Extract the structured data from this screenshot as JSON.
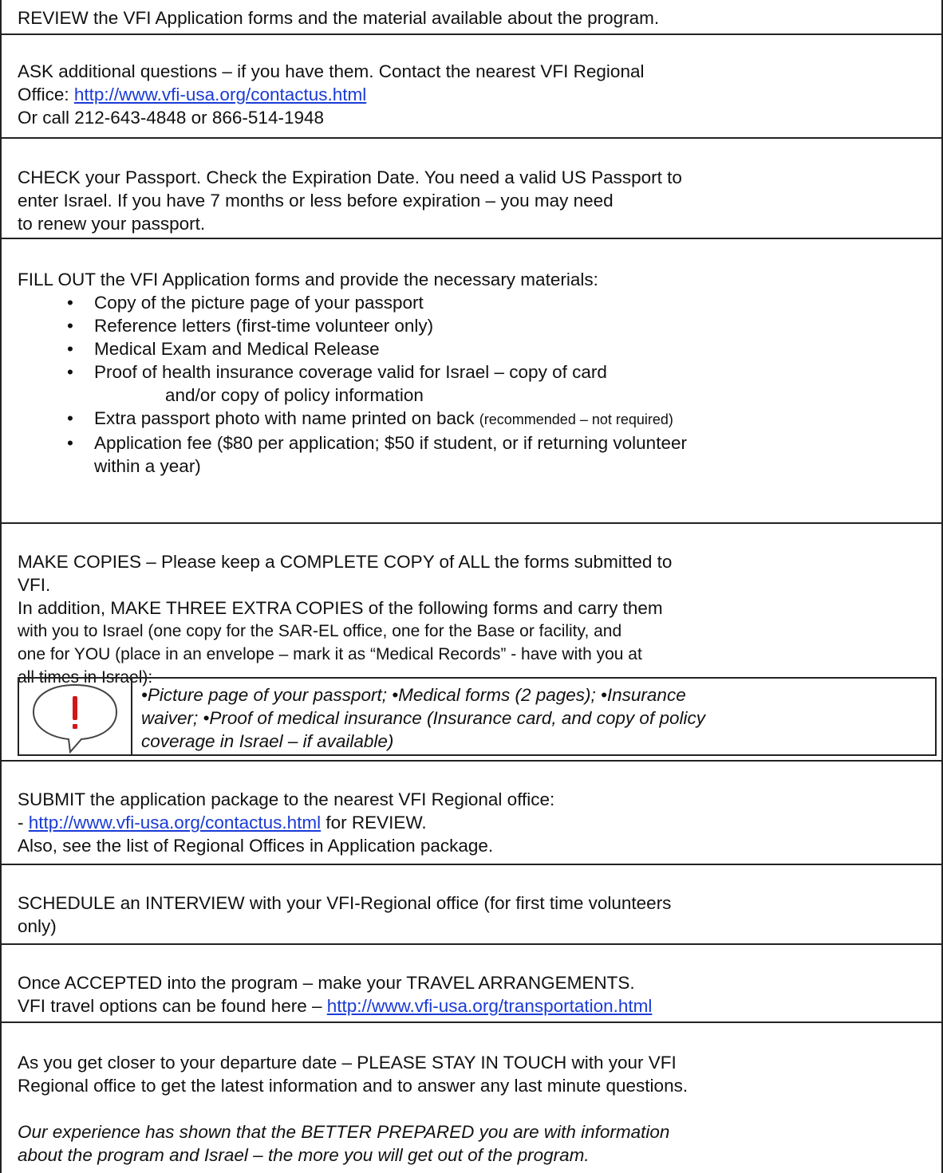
{
  "s1": {
    "line": "REVIEW the VFI Application forms and the material available about the program."
  },
  "s2": {
    "line1": "ASK additional questions – if you have them. Contact the nearest VFI Regional",
    "line2_prefix": "Office: ",
    "link": "http://www.vfi-usa.org/contactus.html",
    "line3": "Or call 212-643-4848 or 866-514-1948"
  },
  "s3": {
    "line1": "CHECK your Passport. Check the Expiration Date. You need a valid US Passport to",
    "line2": "enter Israel.  If you have 7 months or less before expiration – you may need",
    "line3": "to renew your passport."
  },
  "s4": {
    "intro": "FILL OUT the VFI Application forms and provide the necessary materials:",
    "bullet": "•",
    "item1": "Copy of the picture page of your passport",
    "item2": "Reference letters (first-time volunteer only)",
    "item3": "Medical Exam and Medical Release",
    "item4a": "Proof of health insurance coverage valid for Israel – copy of card",
    "item4b": "and/or copy of policy information",
    "item5": "Extra passport photo with name printed on back ",
    "item5_note": "(recommended – not required)",
    "item6a": "Application fee ($80 per application; $50 if student, or if returning volunteer",
    "item6b": "within a year)"
  },
  "s5": {
    "line1": "MAKE COPIES – Please keep a COMPLETE COPY of ALL the forms submitted to",
    "line2": "VFI.",
    "line3": "In addition, MAKE THREE EXTRA COPIES of the following forms and carry them",
    "line4": "with you to Israel (one copy for the SAR-EL office, one for the Base or facility, and",
    "line5": "one for YOU (place in an envelope – mark it as “Medical Records” - have with you at",
    "line6": "all times in Israel):",
    "warn_line1": "•Picture page of your passport; •Medical forms (2 pages); •Insurance",
    "warn_line2": "waiver; •Proof of medical insurance (Insurance card, and copy of policy",
    "warn_line3": "coverage in Israel – if available)",
    "warn_icon": "exclamation-speech-bubble-icon"
  },
  "s6": {
    "line1": "SUBMIT the application package to the nearest VFI Regional office:",
    "line2_prefix": "- ",
    "link": "http://www.vfi-usa.org/contactus.html",
    "line2_suffix": " for REVIEW.",
    "line3": "Also, see the list of Regional Offices in Application package."
  },
  "s7": {
    "line1": "SCHEDULE an INTERVIEW with your VFI-Regional office (for first time volunteers",
    "line2": "only)"
  },
  "s8": {
    "line1": "Once ACCEPTED into the program – make your TRAVEL ARRANGEMENTS.",
    "line2_prefix": "VFI travel options can be found here – ",
    "link": "http://www.vfi-usa.org/transportation.html"
  },
  "s9": {
    "line1": "As you get closer to your departure date – PLEASE STAY IN TOUCH with your VFI",
    "line2": "Regional office to get the latest information and to answer any last minute questions.",
    "line3": "Our experience has shown that the BETTER PREPARED you are with information",
    "line4": "about the program and Israel – the more you will get out of the program."
  },
  "colors": {
    "link": "#1a3bd6",
    "rule": "#222222",
    "warn_red": "#d01818"
  }
}
